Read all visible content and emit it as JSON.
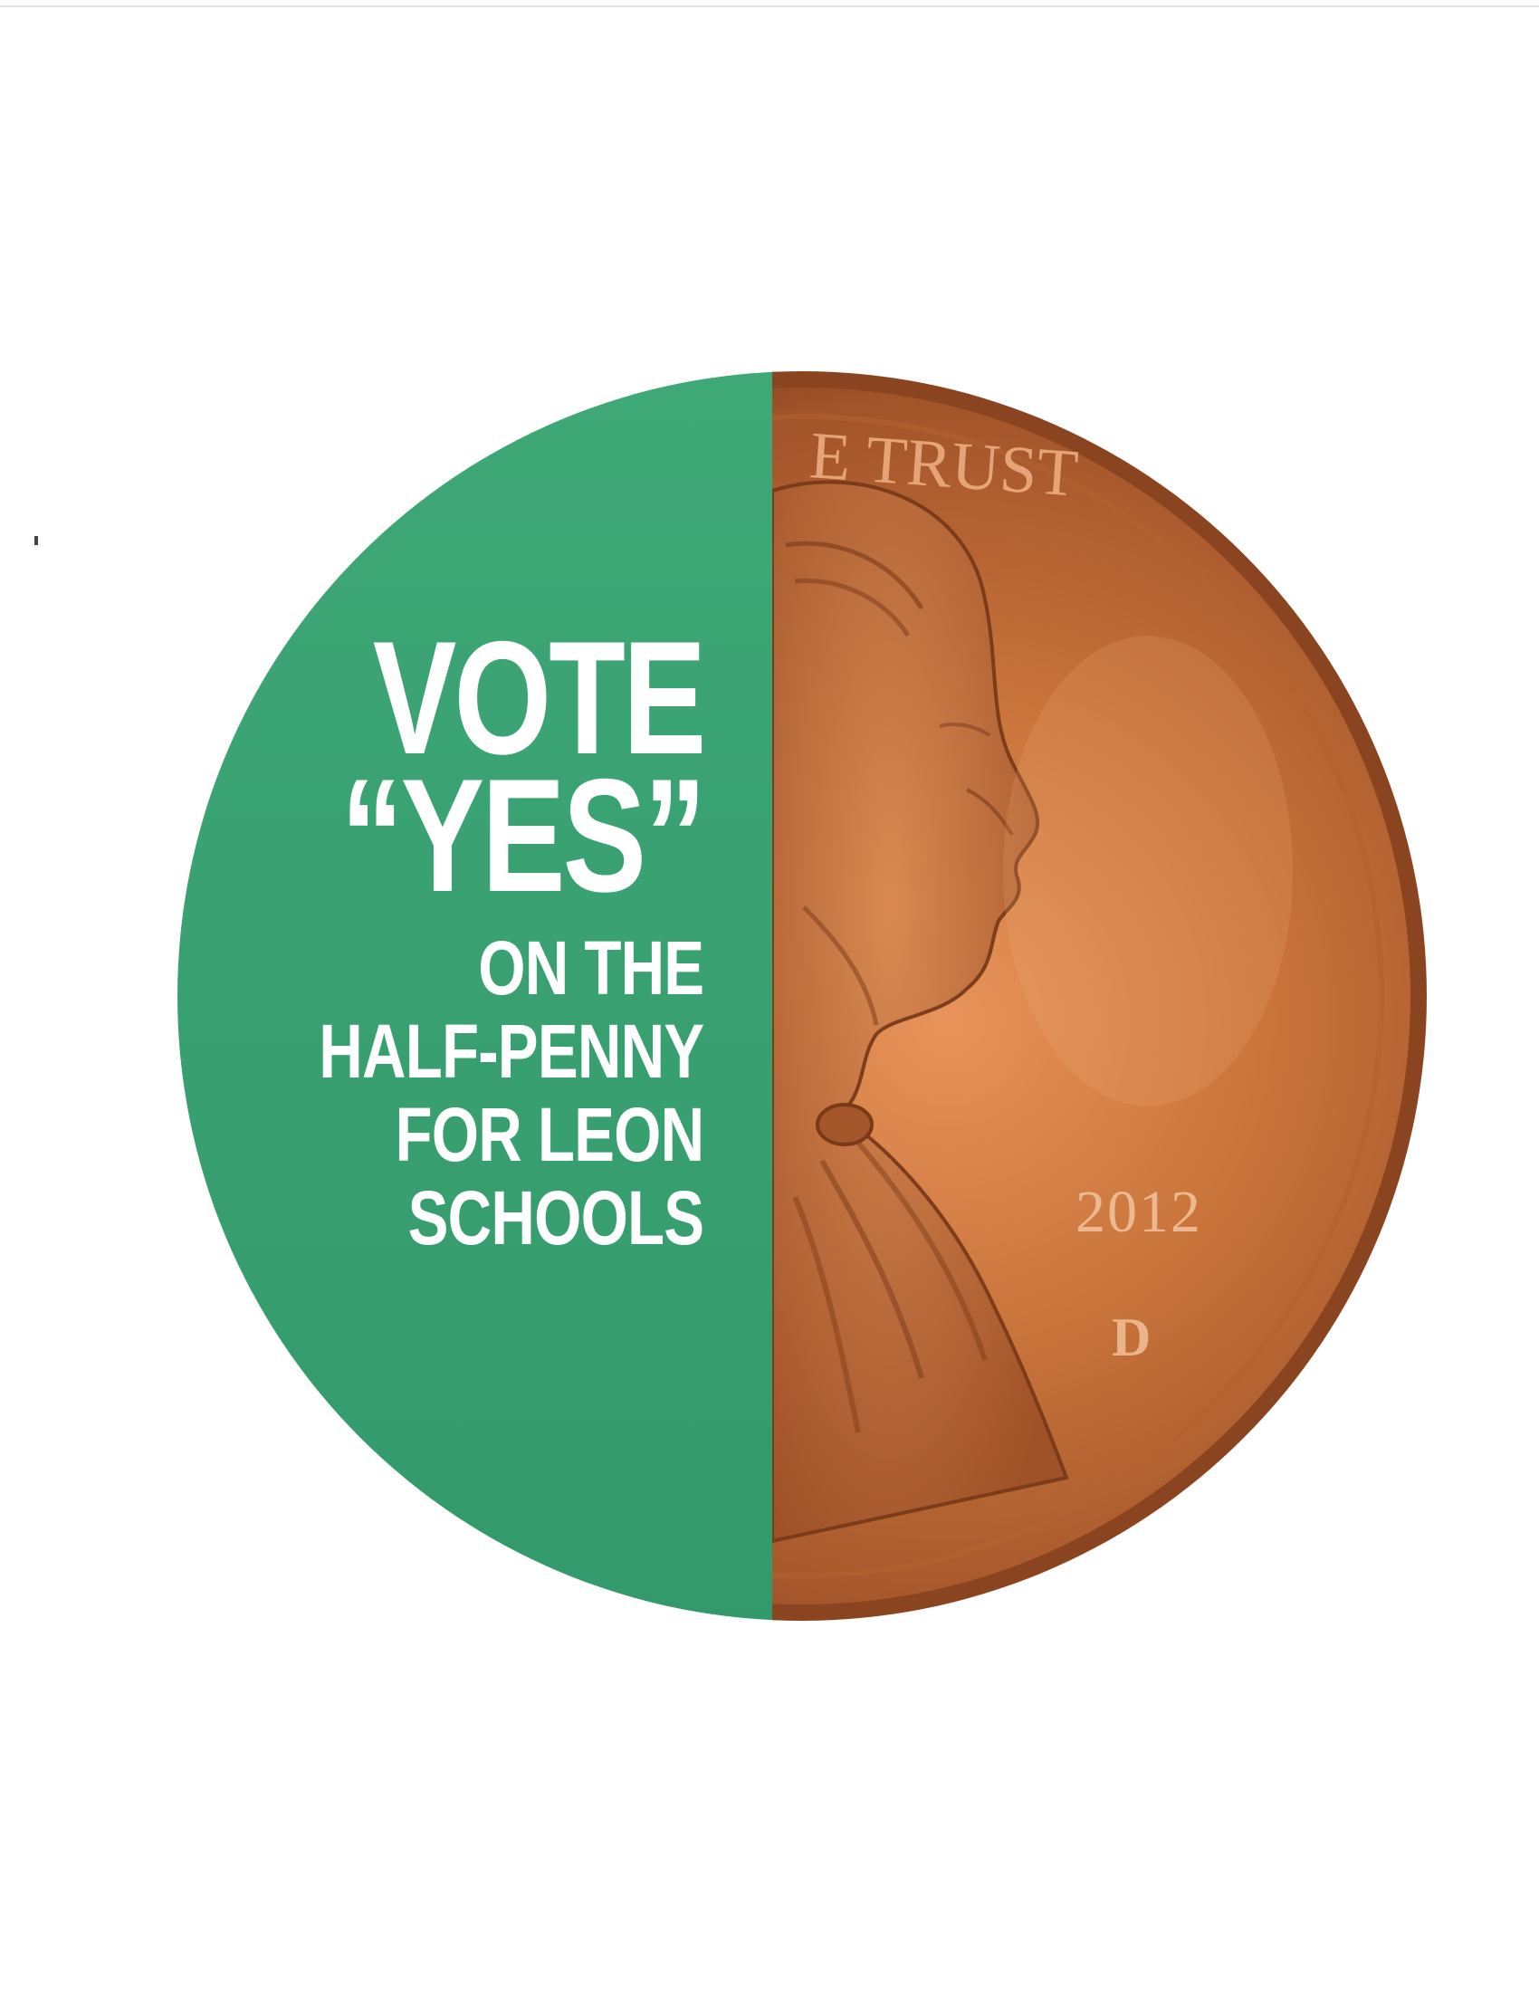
{
  "flyer": {
    "headline": {
      "line1": "VOTE",
      "line2": "“YES”",
      "line3": "ON THE",
      "line4": "HALF-PENNY",
      "line5": "FOR LEON",
      "line6": "SCHOOLS"
    },
    "coin": {
      "rim_text": "E TRUST",
      "year": "2012",
      "mint_mark": "D"
    }
  },
  "colors": {
    "green_panel": "#3aa373",
    "copper": "#c26a32",
    "text": "#ffffff"
  }
}
